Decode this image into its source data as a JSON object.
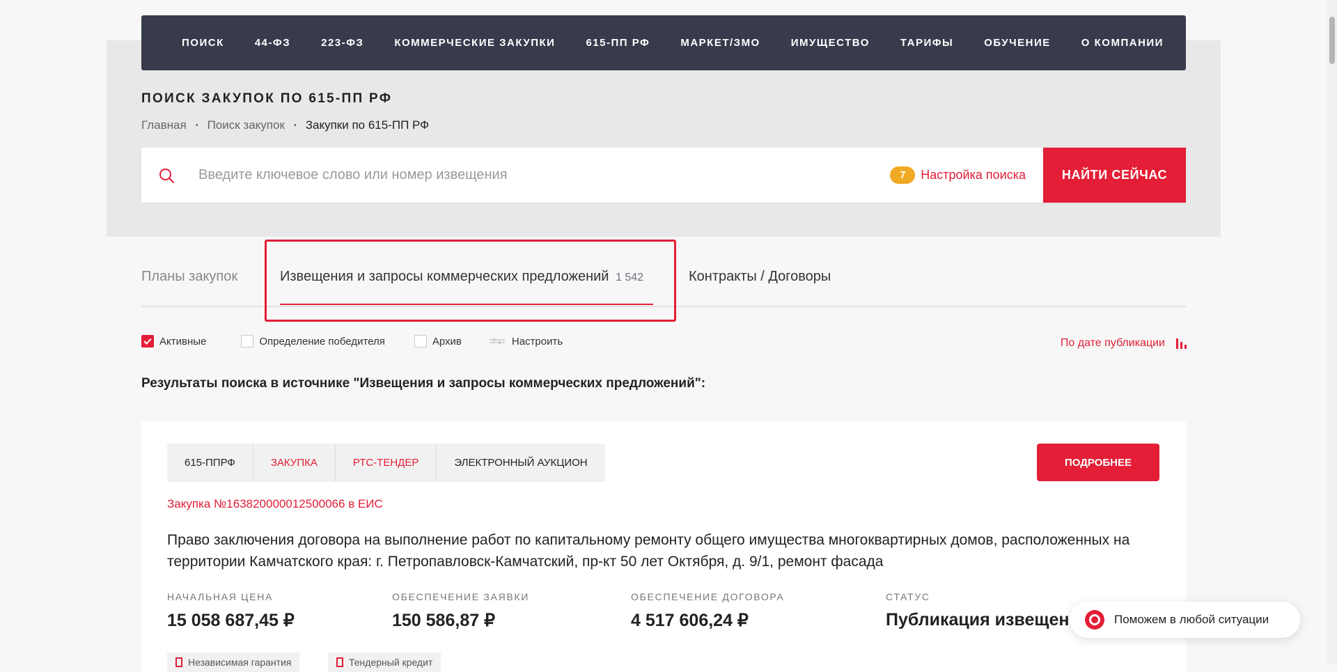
{
  "nav": [
    "ПОИСК",
    "44-ФЗ",
    "223-ФЗ",
    "КОММЕРЧЕСКИЕ ЗАКУПКИ",
    "615-ПП РФ",
    "МАРКЕТ/ЗМО",
    "ИМУЩЕСТВО",
    "ТАРИФЫ",
    "ОБУЧЕНИЕ",
    "О КОМПАНИИ"
  ],
  "page_title": "ПОИСК ЗАКУПОК ПО 615-ПП РФ",
  "breadcrumb": {
    "home": "Главная",
    "search": "Поиск закупок",
    "current": "Закупки по 615-ПП РФ",
    "separator": "•"
  },
  "search": {
    "placeholder": "Введите ключевое слово или номер извещения",
    "value": "",
    "settings_count": "7",
    "settings_label": "Настройка поиска",
    "button": "НАЙТИ СЕЙЧАС",
    "icon": "search-icon"
  },
  "tabs": {
    "plans": "Планы закупок",
    "notices": "Извещения и запросы коммерческих предложений",
    "notices_count": "1 542",
    "contracts": "Контракты / Договоры"
  },
  "filters": {
    "active": "Активные",
    "winner": "Определение победителя",
    "archive": "Архив",
    "configure": "Настроить",
    "sort": "По дате публикации"
  },
  "results_title": "Результаты поиска в источнике \"Извещения и запросы коммерческих предложений\":",
  "card": {
    "tags": [
      "615-ППРФ",
      "ЗАКУПКА",
      "РТС-ТЕНДЕР",
      "ЭЛЕКТРОННЫЙ АУКЦИОН"
    ],
    "more_button": "ПОДРОБНЕЕ",
    "notice_link": "Закупка №163820000012500066 в ЕИС",
    "title": "Право заключения договора на выполнение работ по капитальному ремонту общего имущества многоквартирных домов, расположенных на территории Камчатского края: г. Петропавловск-Камчатский, пр-кт 50 лет Октября, д. 9/1, ремонт фасада",
    "start_price_label": "НАЧАЛЬНАЯ ЦЕНА",
    "start_price": "15 058 687,45 ₽",
    "bid_security_label": "ОБЕСПЕЧЕНИЕ ЗАЯВКИ",
    "bid_security": "150 586,87 ₽",
    "contract_security_label": "ОБЕСПЕЧЕНИЕ ДОГОВОРА",
    "contract_security": "4 517 606,24 ₽",
    "status_label": "СТАТУС",
    "status": "Публикация извещения",
    "extra1": "Независимая гарантия",
    "extra2": "Тендерный кредит"
  },
  "help": {
    "label": "Поможем в любой ситуации"
  },
  "colors": {
    "accent": "#e31e36",
    "nav_bg": "#373b4b",
    "badge": "#f2a923"
  }
}
